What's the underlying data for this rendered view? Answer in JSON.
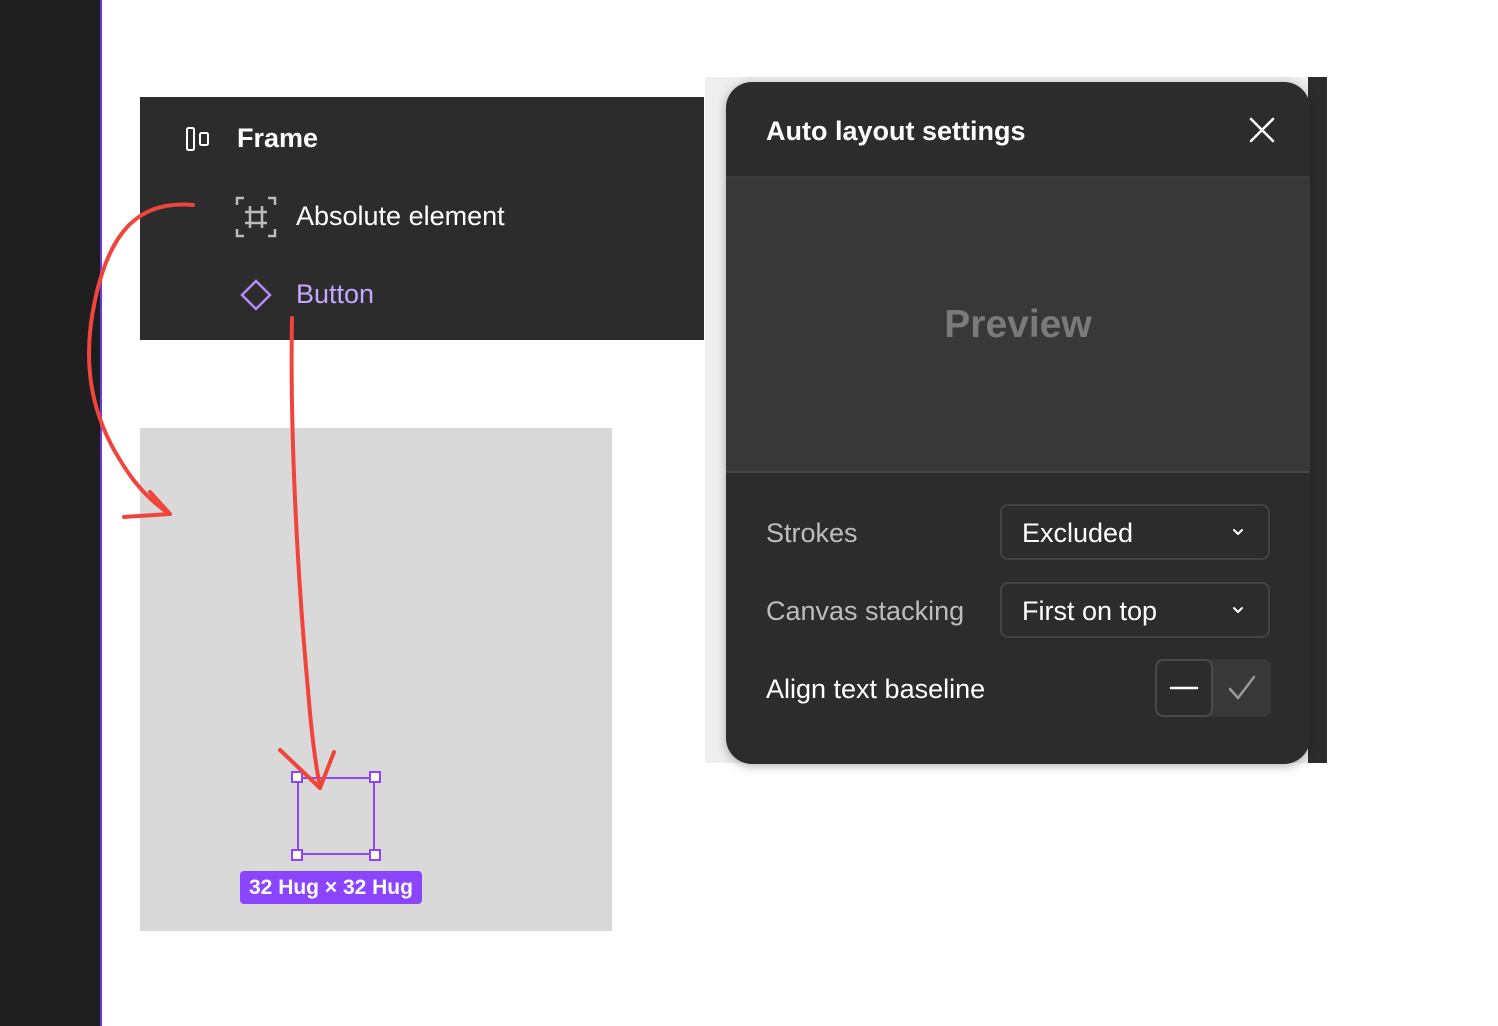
{
  "layers": {
    "items": [
      {
        "label": "Frame",
        "icon": "auto-layout-frame-icon"
      },
      {
        "label": "Absolute element",
        "icon": "absolute-position-icon"
      },
      {
        "label": "Button",
        "icon": "component-instance-icon"
      }
    ]
  },
  "canvas": {
    "size_badge": "32 Hug × 32 Hug"
  },
  "popup": {
    "title": "Auto layout settings",
    "preview_label": "Preview",
    "strokes": {
      "label": "Strokes",
      "value": "Excluded"
    },
    "canvas_stacking": {
      "label": "Canvas stacking",
      "value": "First on top"
    },
    "align_baseline": {
      "label": "Align text baseline",
      "selected": "dash"
    }
  },
  "colors": {
    "accent_purple": "#8b45ff",
    "component_purple": "#c6a6ff",
    "annotation_red": "#f0453c",
    "panel_bg": "#2c2c2c"
  }
}
